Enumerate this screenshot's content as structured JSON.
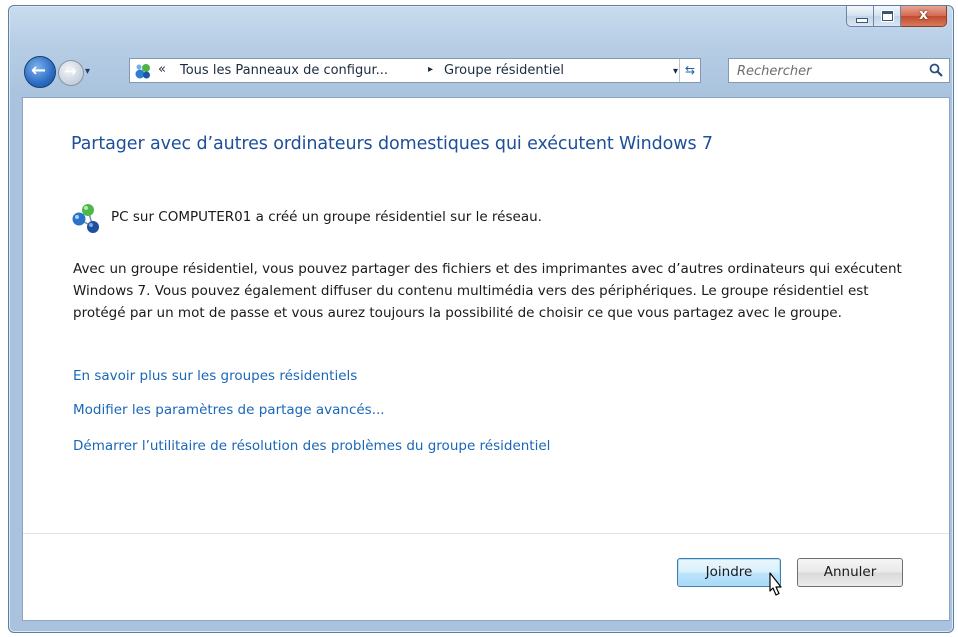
{
  "window": {
    "caption_buttons": {
      "minimize": "─",
      "maximize": "□",
      "close": "x"
    }
  },
  "navbar": {
    "back_glyph": "←",
    "forward_glyph": "→",
    "address": {
      "overflow": "«",
      "crumb1": "Tous les Panneaux de configur...",
      "separator": "▸",
      "crumb2": "Groupe résidentiel",
      "dropdown": "▾",
      "refresh": "⇆"
    },
    "search": {
      "placeholder": "Rechercher"
    }
  },
  "main": {
    "title": "Partager avec d’autres ordinateurs domestiques qui exécutent Windows 7",
    "status": "PC sur COMPUTER01 a créé un groupe résidentiel sur le réseau.",
    "description": "Avec un groupe résidentiel, vous pouvez partager des fichiers et des imprimantes avec d’autres ordinateurs qui exécutent Windows 7. Vous pouvez également diffuser du contenu multimédia vers des périphériques. Le groupe résidentiel est protégé par un mot de passe et vous aurez toujours la possibilité de choisir ce que vous partagez avec le groupe.",
    "links": [
      "En savoir plus sur les groupes résidentiels",
      "Modifier les paramètres de partage avancés...",
      "Démarrer l’utilitaire de résolution des problèmes du groupe résidentiel"
    ]
  },
  "footer": {
    "join_label": "Joindre",
    "cancel_label": "Annuler"
  },
  "icons": {
    "homegroup": "homegroup-icon",
    "search": "search-icon",
    "cursor": "mouse-pointer-icon"
  },
  "colors": {
    "title": "#1e4f9a",
    "link": "#1a67b8",
    "close_button": "#c24a2e"
  }
}
